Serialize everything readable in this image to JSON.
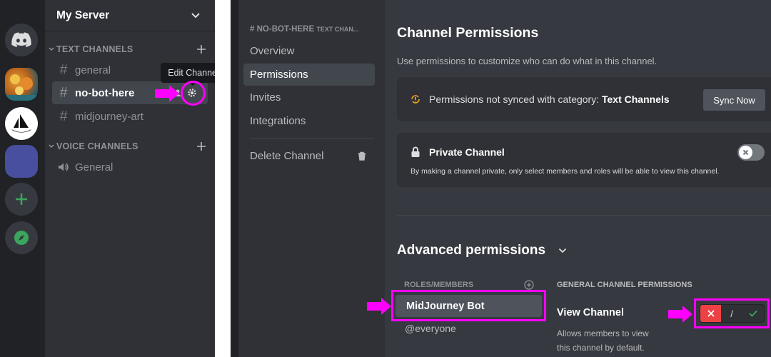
{
  "server": {
    "name": "My Server"
  },
  "categories": {
    "text": "TEXT CHANNELS",
    "voice": "VOICE CHANNELS"
  },
  "channels": {
    "general": "general",
    "no_bot_here": "no-bot-here",
    "midjourney_art": "midjourney-art",
    "voice_general": "General"
  },
  "tooltip": {
    "edit_channel": "Edit Channel"
  },
  "settings_nav": {
    "header_hash": "#",
    "header": "NO-BOT-HERE",
    "header_sub": "TEXT CHAN...",
    "items": [
      "Overview",
      "Permissions",
      "Invites",
      "Integrations"
    ],
    "delete": "Delete Channel"
  },
  "permissions": {
    "title": "Channel Permissions",
    "subtitle": "Use permissions to customize who can do what in this channel.",
    "sync_text": "Permissions not synced with category: ",
    "sync_category": "Text Channels",
    "sync_button": "Sync Now",
    "private_title": "Private Channel",
    "private_desc": "By making a channel private, only select members and roles will be able to view this channel.",
    "advanced_title": "Advanced permissions",
    "roles_header": "ROLES/MEMBERS",
    "general_header": "GENERAL CHANNEL PERMISSIONS",
    "roles": [
      "MidJourney Bot",
      "@everyone"
    ],
    "view_channel": "View Channel",
    "view_channel_desc_1": "Allows members to view",
    "view_channel_desc_2": "this channel by default.",
    "toggle_slash": "/"
  },
  "colors": {
    "brand": "#5865f2",
    "deny": "#ed4245",
    "allow": "#3ba55d",
    "highlight": "#ff00ff"
  }
}
